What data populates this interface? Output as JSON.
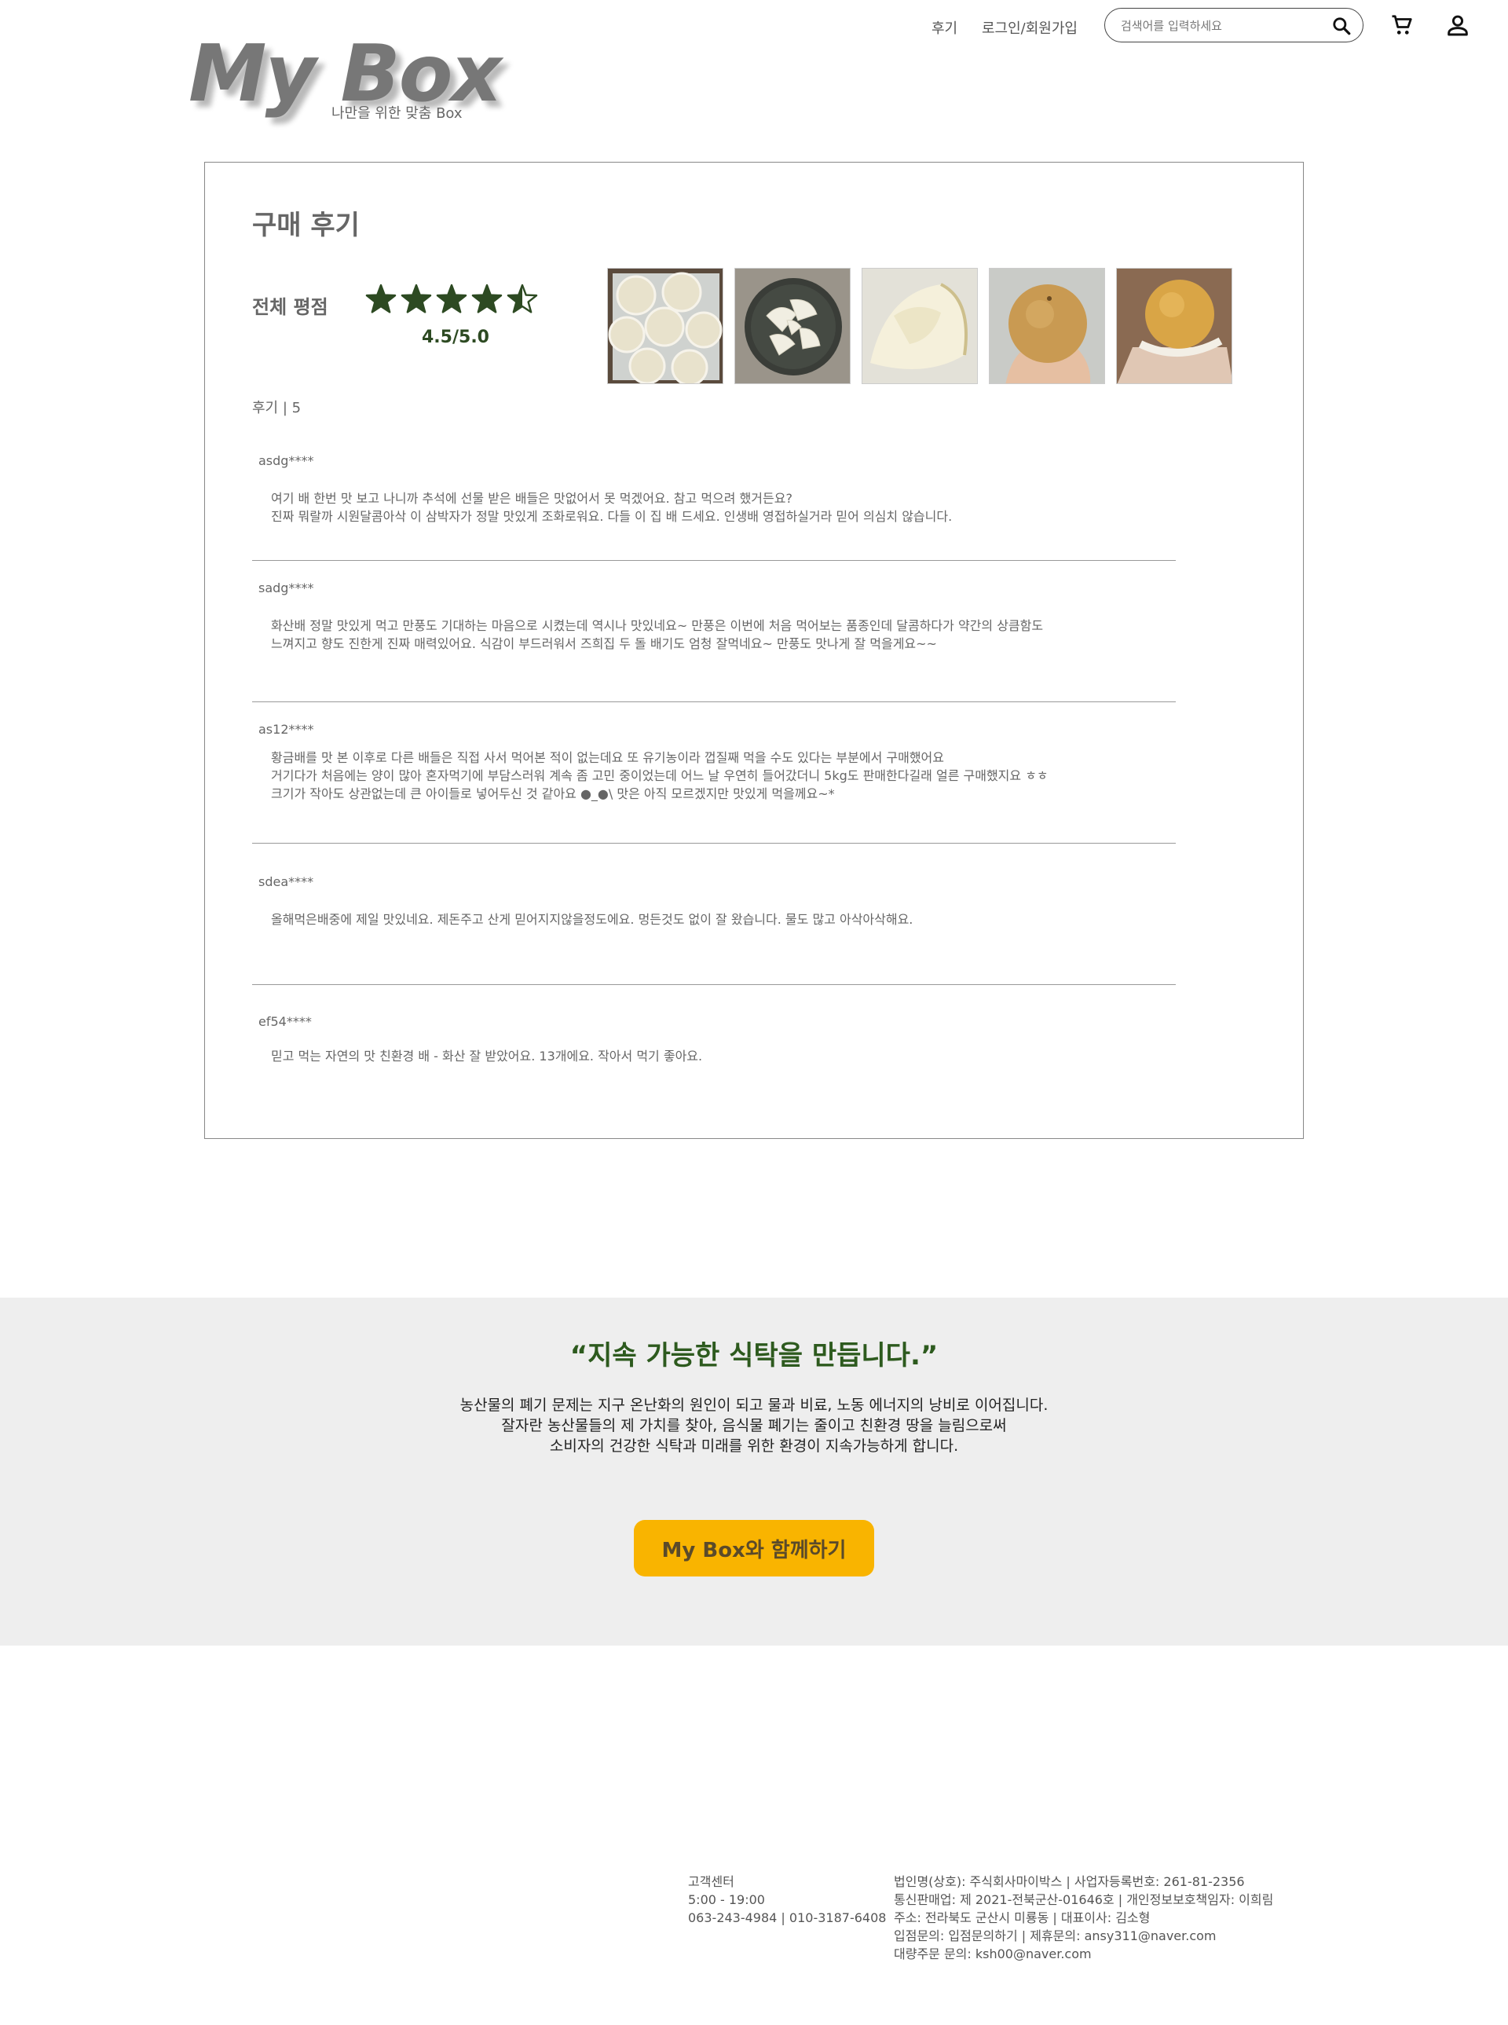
{
  "header": {
    "logo_text": "My Box",
    "logo_subtitle": "나만을 위한 맞춤 Box",
    "nav_review": "후기",
    "nav_login": "로그인/회원가입",
    "search_placeholder": "검색어를 입력하세요"
  },
  "reviews_section": {
    "title": "구매 후기",
    "rating_label": "전체 평점",
    "rating_value": 4.5,
    "rating_text": "4.5/5.0",
    "star_color": "#2d4a22",
    "count_text": "후기 | 5",
    "photos": [
      "pears-boxed-photo",
      "sliced-pear-plate-photo",
      "pear-slice-closeup-photo",
      "pear-in-hand-photo",
      "wrapped-pear-photo"
    ],
    "reviews": [
      {
        "author": "asdg****",
        "lines": [
          "여기 배 한번 맛 보고 나니까 추석에 선물 받은 배들은 맛없어서 못 먹겠어요. 참고 먹으려 했거든요?",
          "진짜 뭐랄까 시원달콤아삭 이 삼박자가 정말 맛있게 조화로워요. 다들 이 집 배 드세요. 인생배 영접하실거라 믿어 의심치 않습니다."
        ]
      },
      {
        "author": "sadg****",
        "lines": [
          "화산배 정말 맛있게 먹고 만풍도 기대하는 마음으로 시켰는데 역시나 맛있네요~ 만풍은 이번에 처음 먹어보는 품종인데 달콤하다가 약간의 상큼함도",
          "느껴지고 향도 진한게 진짜 매력있어요. 식감이 부드러워서 즈희집 두 돌 배기도 엄청 잘먹네요~ 만풍도 맛나게 잘 먹을게요~~"
        ]
      },
      {
        "author": "as12****",
        "lines": [
          "황금배를 맛 본 이후로 다른 배들은 직접 사서 먹어본 적이 없는데요 또 유기농이라 껍질째 먹을 수도 있다는 부분에서 구매했어요",
          "거기다가 처음에는 양이 많아 혼자먹기에 부담스러워 계속 좀 고민 중이었는데 어느 날 우연히 들어갔더니 5kg도 판매한다길래 얼른 구매했지요 ㅎㅎ",
          "크기가 작아도 상관없는데 큰 아이들로 넣어두신 것 같아요 ●_●\\ 맛은 아직 모르겠지만 맛있게 먹을께요~*"
        ]
      },
      {
        "author": "sdea****",
        "lines": [
          "올해먹은배중에 제일 맛있네요. 제돈주고 산게 믿어지지않을정도에요. 멍든것도 없이 잘 왔습니다. 물도 많고 아삭아삭해요."
        ]
      },
      {
        "author": "ef54****",
        "lines": [
          "믿고 먹는 자연의 맛 친환경 배 - 화산 잘 받았어요. 13개에요. 작아서 먹기 좋아요."
        ]
      }
    ]
  },
  "mission": {
    "quote": "“지속 가능한 식탁을 만듭니다.”",
    "lines": [
      "농산물의 폐기 문제는 지구 온난화의 원인이 되고 물과 비료, 노동 에너지의 낭비로 이어집니다.",
      "잘자란 농산물들의 제 가치를 찾아, 음식물 폐기는 줄이고 친환경 땅을 늘림으로써",
      "소비자의 건강한 식탁과 미래를 위한 환경이 지속가능하게 합니다."
    ],
    "cta": "My Box와 함께하기",
    "cta_color": "#f9b400"
  },
  "footer": {
    "cs_lines": [
      "고객센터",
      "5:00 - 19:00",
      "063-243-4984 | 010-3187-6408"
    ],
    "company_lines": [
      "법인명(상호): 주식회사마이박스 | 사업자등록번호: 261-81-2356",
      "통신판매업: 제 2021-전북군산-01646호 | 개인정보보호책임자: 이희림",
      "주소: 전라북도 군산시 미룡동 | 대표이사: 김소형",
      "입점문의: 입점문의하기 | 제휴문의: ansy311@naver.com",
      "대량주문 문의: ksh00@naver.com"
    ]
  }
}
